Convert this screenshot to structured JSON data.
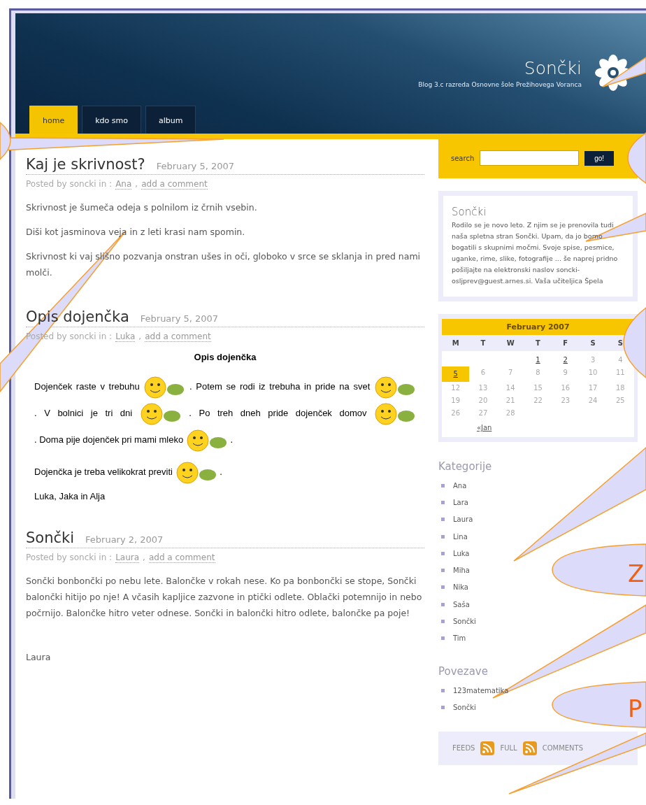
{
  "header": {
    "title": "Sončki",
    "tagline": "Blog 3.c razreda Osnovne šole Prežihovega Voranca"
  },
  "nav": [
    {
      "label": "home",
      "selected": true
    },
    {
      "label": "kdo smo",
      "selected": false
    },
    {
      "label": "album",
      "selected": false
    }
  ],
  "posts": [
    {
      "title": "Kaj je skrivnost?",
      "date": "February 5, 2007",
      "meta": "Posted by soncki in :",
      "category": "Ana",
      "separator": ",",
      "comment": "add a comment",
      "body": [
        {
          "kind": "text",
          "text": "Skrivnost je šumeča odeja s polnilom iz črnih vsebin."
        },
        {
          "kind": "text",
          "text": "Diši kot jasminova veja in z leti krasi nam spomin."
        },
        {
          "kind": "text",
          "text": "Skrivnost ki vaj slišno pozvanja onstran ušes in oči, globoko v srce se sklanja in pred nami molči."
        }
      ]
    },
    {
      "title": "Opis dojenčka",
      "date": "February 5, 2007",
      "meta": "Posted by soncki in :",
      "category": "Luka",
      "separator": ",",
      "comment": "add a comment",
      "body": [
        {
          "kind": "heading",
          "text": "Opis dojenčka"
        },
        {
          "kind": "mixed",
          "parts": [
            {
              "kind": "text",
              "text": "Dojenček raste  v trebuhu"
            },
            {
              "kind": "emoticon"
            },
            {
              "kind": "text",
              "text": ". Potem se rodi iz trebuha in pride na"
            },
            {
              "kind": "text",
              "text": "svet"
            },
            {
              "kind": "emoticon"
            },
            {
              "kind": "text",
              "text": ". V bolnici je tri dni"
            },
            {
              "kind": "emoticon"
            },
            {
              "kind": "text",
              "text": ". Po treh dneh pride"
            },
            {
              "kind": "text",
              "text": "dojenček domov"
            },
            {
              "kind": "emoticon"
            },
            {
              "kind": "text",
              "text": ". Doma pije dojenček pri mami mleko"
            },
            {
              "kind": "emoticon"
            },
            {
              "kind": "text",
              "text": "."
            }
          ]
        },
        {
          "kind": "mixed",
          "parts": [
            {
              "kind": "text",
              "text": "Dojenčka je treba velikokrat previti"
            },
            {
              "kind": "emoticon"
            },
            {
              "kind": "text",
              "text": "."
            }
          ]
        },
        {
          "kind": "sans",
          "text": "Luka, Jaka in Alja"
        }
      ]
    },
    {
      "title": "Sončki",
      "date": "February 2, 2007",
      "meta": "Posted by soncki in :",
      "category": "Laura",
      "separator": ",",
      "comment": "add a comment",
      "body": [
        {
          "kind": "text",
          "text": "Sončki bonbončki po nebu lete. Balončke v rokah nese. Ko pa bonbončki se stope, Sončki balončki hitijo po nje! A včasih kapljice zazvone in ptički odlete. Oblački potemnijo in nebo počrnijo. Balončke hitro veter odnese. Sončki in balončki hitro odlete, balončke pa poje!"
        },
        {
          "kind": "gap"
        },
        {
          "kind": "text",
          "text": "Laura"
        }
      ]
    }
  ],
  "sidebar": {
    "search": {
      "label": "search",
      "button": "go!"
    },
    "about": {
      "title": "Sončki",
      "text": "Rodilo se je novo leto. Z njim se je prenovila tudi naša spletna stran Sončki. Upam, da jo bomo bogatili s skupnimi močmi. Svoje spise, pesmice, uganke, rime, slike, fotografije ... še naprej pridno pošiljajte na elektronski naslov soncki-osljprev@guest.arnes.si. Vaša učiteljica Špela"
    },
    "calendar": {
      "month": "February 2007",
      "weekdays": [
        "M",
        "T",
        "W",
        "T",
        "F",
        "S",
        "S"
      ],
      "weeks": [
        [
          {
            "day": "1",
            "link": true,
            "selected": false
          },
          {
            "day": "2",
            "link": true,
            "selected": false
          },
          {
            "day": "3",
            "link": false,
            "selected": false
          },
          {
            "day": "4",
            "link": false,
            "selected": false
          }
        ],
        [
          {
            "day": "5",
            "link": true,
            "selected": true
          },
          {
            "day": "6",
            "link": false,
            "selected": false
          },
          {
            "day": "7",
            "link": false,
            "selected": false
          },
          {
            "day": "8",
            "link": false,
            "selected": false
          },
          {
            "day": "9",
            "link": false,
            "selected": false
          },
          {
            "day": "10",
            "link": false,
            "selected": false
          },
          {
            "day": "11",
            "link": false,
            "selected": false
          }
        ],
        [
          {
            "day": "12",
            "link": false,
            "selected": false
          },
          {
            "day": "13",
            "link": false,
            "selected": false
          },
          {
            "day": "14",
            "link": false,
            "selected": false
          },
          {
            "day": "15",
            "link": false,
            "selected": false
          },
          {
            "day": "16",
            "link": false,
            "selected": false
          },
          {
            "day": "17",
            "link": false,
            "selected": false
          },
          {
            "day": "18",
            "link": false,
            "selected": false
          }
        ],
        [
          {
            "day": "19",
            "link": false,
            "selected": false
          },
          {
            "day": "20",
            "link": false,
            "selected": false
          },
          {
            "day": "21",
            "link": false,
            "selected": false
          },
          {
            "day": "22",
            "link": false,
            "selected": false
          },
          {
            "day": "23",
            "link": false,
            "selected": false
          },
          {
            "day": "24",
            "link": false,
            "selected": false
          },
          {
            "day": "25",
            "link": false,
            "selected": false
          }
        ],
        [
          {
            "day": "26",
            "link": false,
            "selected": false
          },
          {
            "day": "27",
            "link": false,
            "selected": false
          },
          {
            "day": "28",
            "link": false,
            "selected": false
          }
        ]
      ],
      "prev": "«Jan"
    },
    "categories": {
      "title": "Kategorije",
      "items": [
        "Ana",
        "Lara",
        "Laura",
        "Lina",
        "Luka",
        "Miha",
        "Nika",
        "Saša",
        "Sončki",
        "Tim"
      ]
    },
    "links": {
      "title": "Povezave",
      "items": [
        "123matematika",
        "Sončki"
      ]
    },
    "feeds": {
      "label": "FEEDS",
      "items": [
        "FULL",
        "COMMENTS"
      ]
    }
  },
  "callout_labels": [
    "Z",
    "P"
  ]
}
